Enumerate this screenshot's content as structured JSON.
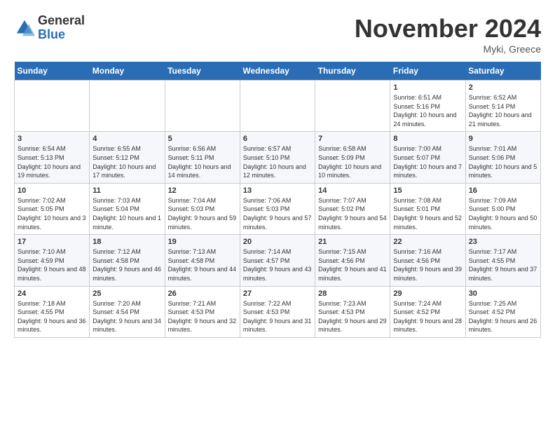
{
  "logo": {
    "general": "General",
    "blue": "Blue"
  },
  "title": "November 2024",
  "location": "Myki, Greece",
  "days_of_week": [
    "Sunday",
    "Monday",
    "Tuesday",
    "Wednesday",
    "Thursday",
    "Friday",
    "Saturday"
  ],
  "weeks": [
    [
      {
        "day": "",
        "info": ""
      },
      {
        "day": "",
        "info": ""
      },
      {
        "day": "",
        "info": ""
      },
      {
        "day": "",
        "info": ""
      },
      {
        "day": "",
        "info": ""
      },
      {
        "day": "1",
        "info": "Sunrise: 6:51 AM\nSunset: 5:16 PM\nDaylight: 10 hours and 24 minutes."
      },
      {
        "day": "2",
        "info": "Sunrise: 6:52 AM\nSunset: 5:14 PM\nDaylight: 10 hours and 21 minutes."
      }
    ],
    [
      {
        "day": "3",
        "info": "Sunrise: 6:54 AM\nSunset: 5:13 PM\nDaylight: 10 hours and 19 minutes."
      },
      {
        "day": "4",
        "info": "Sunrise: 6:55 AM\nSunset: 5:12 PM\nDaylight: 10 hours and 17 minutes."
      },
      {
        "day": "5",
        "info": "Sunrise: 6:56 AM\nSunset: 5:11 PM\nDaylight: 10 hours and 14 minutes."
      },
      {
        "day": "6",
        "info": "Sunrise: 6:57 AM\nSunset: 5:10 PM\nDaylight: 10 hours and 12 minutes."
      },
      {
        "day": "7",
        "info": "Sunrise: 6:58 AM\nSunset: 5:09 PM\nDaylight: 10 hours and 10 minutes."
      },
      {
        "day": "8",
        "info": "Sunrise: 7:00 AM\nSunset: 5:07 PM\nDaylight: 10 hours and 7 minutes."
      },
      {
        "day": "9",
        "info": "Sunrise: 7:01 AM\nSunset: 5:06 PM\nDaylight: 10 hours and 5 minutes."
      }
    ],
    [
      {
        "day": "10",
        "info": "Sunrise: 7:02 AM\nSunset: 5:05 PM\nDaylight: 10 hours and 3 minutes."
      },
      {
        "day": "11",
        "info": "Sunrise: 7:03 AM\nSunset: 5:04 PM\nDaylight: 10 hours and 1 minute."
      },
      {
        "day": "12",
        "info": "Sunrise: 7:04 AM\nSunset: 5:03 PM\nDaylight: 9 hours and 59 minutes."
      },
      {
        "day": "13",
        "info": "Sunrise: 7:06 AM\nSunset: 5:03 PM\nDaylight: 9 hours and 57 minutes."
      },
      {
        "day": "14",
        "info": "Sunrise: 7:07 AM\nSunset: 5:02 PM\nDaylight: 9 hours and 54 minutes."
      },
      {
        "day": "15",
        "info": "Sunrise: 7:08 AM\nSunset: 5:01 PM\nDaylight: 9 hours and 52 minutes."
      },
      {
        "day": "16",
        "info": "Sunrise: 7:09 AM\nSunset: 5:00 PM\nDaylight: 9 hours and 50 minutes."
      }
    ],
    [
      {
        "day": "17",
        "info": "Sunrise: 7:10 AM\nSunset: 4:59 PM\nDaylight: 9 hours and 48 minutes."
      },
      {
        "day": "18",
        "info": "Sunrise: 7:12 AM\nSunset: 4:58 PM\nDaylight: 9 hours and 46 minutes."
      },
      {
        "day": "19",
        "info": "Sunrise: 7:13 AM\nSunset: 4:58 PM\nDaylight: 9 hours and 44 minutes."
      },
      {
        "day": "20",
        "info": "Sunrise: 7:14 AM\nSunset: 4:57 PM\nDaylight: 9 hours and 43 minutes."
      },
      {
        "day": "21",
        "info": "Sunrise: 7:15 AM\nSunset: 4:56 PM\nDaylight: 9 hours and 41 minutes."
      },
      {
        "day": "22",
        "info": "Sunrise: 7:16 AM\nSunset: 4:56 PM\nDaylight: 9 hours and 39 minutes."
      },
      {
        "day": "23",
        "info": "Sunrise: 7:17 AM\nSunset: 4:55 PM\nDaylight: 9 hours and 37 minutes."
      }
    ],
    [
      {
        "day": "24",
        "info": "Sunrise: 7:18 AM\nSunset: 4:55 PM\nDaylight: 9 hours and 36 minutes."
      },
      {
        "day": "25",
        "info": "Sunrise: 7:20 AM\nSunset: 4:54 PM\nDaylight: 9 hours and 34 minutes."
      },
      {
        "day": "26",
        "info": "Sunrise: 7:21 AM\nSunset: 4:53 PM\nDaylight: 9 hours and 32 minutes."
      },
      {
        "day": "27",
        "info": "Sunrise: 7:22 AM\nSunset: 4:53 PM\nDaylight: 9 hours and 31 minutes."
      },
      {
        "day": "28",
        "info": "Sunrise: 7:23 AM\nSunset: 4:53 PM\nDaylight: 9 hours and 29 minutes."
      },
      {
        "day": "29",
        "info": "Sunrise: 7:24 AM\nSunset: 4:52 PM\nDaylight: 9 hours and 28 minutes."
      },
      {
        "day": "30",
        "info": "Sunrise: 7:25 AM\nSunset: 4:52 PM\nDaylight: 9 hours and 26 minutes."
      }
    ]
  ]
}
